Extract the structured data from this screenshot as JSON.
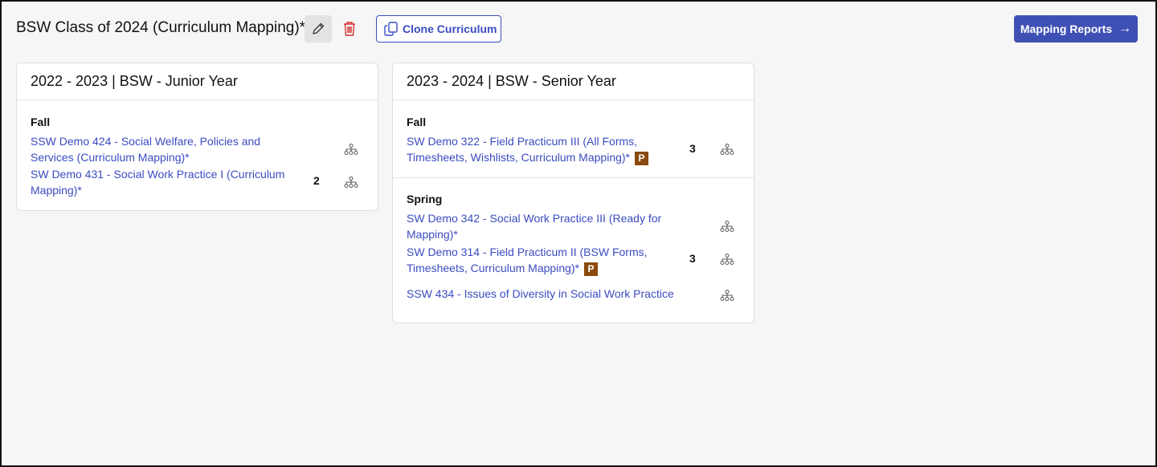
{
  "header": {
    "title": "BSW Class of 2024 (Curriculum Mapping)*",
    "clone_label": "Clone Curriculum",
    "reports_label": "Mapping Reports",
    "reports_arrow": "→"
  },
  "colors": {
    "primary": "#3f50b5",
    "link": "#3b4cc0",
    "delete": "#d32f2f",
    "badge": "#8a4a0f"
  },
  "years": [
    {
      "title": "2022 - 2023 | BSW - Junior Year",
      "terms": [
        {
          "name": "Fall",
          "courses": [
            {
              "name": "SSW Demo 424 - Social Welfare, Policies and Services (Curriculum Mapping)*",
              "badge": "",
              "count": ""
            },
            {
              "name": "SW Demo 431 - Social Work Practice I (Curriculum Mapping)*",
              "badge": "",
              "count": "2"
            }
          ]
        }
      ]
    },
    {
      "title": "2023 - 2024 | BSW - Senior Year",
      "terms": [
        {
          "name": "Fall",
          "courses": [
            {
              "name": "SW Demo 322 - Field Practicum III (All Forms, Timesheets, Wishlists, Curriculum Mapping)*",
              "badge": "P",
              "count": "3"
            }
          ]
        },
        {
          "name": "Spring",
          "courses": [
            {
              "name": "SW Demo 342 - Social Work Practice III (Ready for Mapping)*",
              "badge": "",
              "count": ""
            },
            {
              "name": "SW Demo 314 - Field Practicum II (BSW Forms, Timesheets, Curriculum Mapping)*",
              "badge": "P",
              "count": "3"
            },
            {
              "name": "SSW 434 - Issues of Diversity in Social Work Practice",
              "badge": "",
              "count": ""
            }
          ]
        }
      ]
    }
  ]
}
